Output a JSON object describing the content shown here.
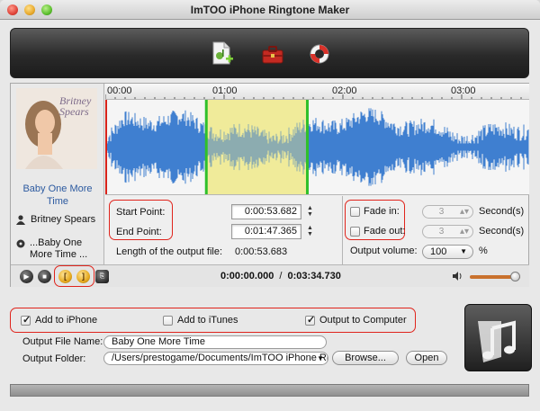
{
  "window": {
    "title": "ImTOO iPhone Ringtone Maker"
  },
  "toolbar": {
    "add_icon": "add-file-icon",
    "toolbox_icon": "toolbox-icon",
    "help_icon": "help-lifebuoy-icon"
  },
  "track": {
    "album_art_text": "Britney Spears",
    "title": "Baby One More Time",
    "artist": "Britney Spears",
    "album": "...Baby One More Time ..."
  },
  "timeline": {
    "ticks": [
      "00:00",
      "01:00",
      "02:00",
      "03:00"
    ]
  },
  "clip": {
    "start_label": "Start Point:",
    "start_value": "0:00:53.682",
    "end_label": "End Point:",
    "end_value": "0:01:47.365",
    "length_label": "Length of the output file:",
    "length_value": "0:00:53.683",
    "start_fraction": 0.2383,
    "end_fraction": 0.4766
  },
  "fade": {
    "fade_in_label": "Fade in:",
    "fade_in_value": "3",
    "fade_in_unit": "Second(s)",
    "fade_out_label": "Fade out:",
    "fade_out_value": "3",
    "fade_out_unit": "Second(s)",
    "volume_label": "Output volume:",
    "volume_value": "100",
    "volume_unit": "%"
  },
  "player": {
    "position": "0:00:00.000",
    "separator": "/",
    "duration": "0:03:34.730",
    "mark_start_label": "[",
    "mark_end_label": "]",
    "volume_level": 0.9
  },
  "output": {
    "add_iphone_label": "Add to iPhone",
    "add_iphone_checked": true,
    "add_itunes_label": "Add to iTunes",
    "add_itunes_checked": false,
    "output_computer_label": "Output to Computer",
    "output_computer_checked": true,
    "file_name_label": "Output File Name:",
    "file_name_value": "Baby One More Time",
    "folder_label": "Output Folder:",
    "folder_value": "/Users/prestogame/Documents/ImTOO iPhone Rin",
    "browse_label": "Browse...",
    "open_label": "Open"
  }
}
